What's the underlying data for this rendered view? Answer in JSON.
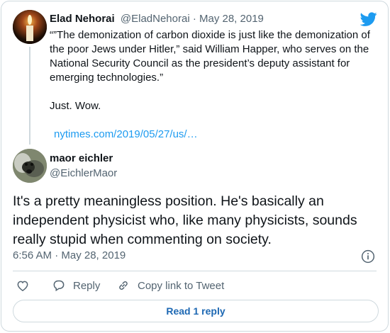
{
  "parent": {
    "name": "Elad Nehorai",
    "handle": "@EladNehorai · May 28, 2019",
    "text_lines": [
      "“”The demonization of carbon dioxide is just like the demonization of the poor Jews under Hitler,” said William Happer, who serves on the National Security Council as the president’s deputy assistant for emerging technologies.”"
    ],
    "text_wow": "Just. Wow.",
    "link": "nytimes.com/2019/05/27/us/…"
  },
  "reply": {
    "name": "maor eichler",
    "handle": "@EichlerMaor",
    "text": "It's a pretty meaningless position. He's basically an independent physicist who, like many physicists, sounds really stupid when commenting on society.",
    "timestamp": "6:56 AM · May 28, 2019"
  },
  "actions": {
    "reply_label": "Reply",
    "copy_label": "Copy link to Tweet"
  },
  "read_replies_label": "Read 1 reply",
  "icons": {
    "twitter": "twitter-bird-icon",
    "like": "heart-icon",
    "reply": "comment-icon",
    "copy": "link-icon",
    "info": "info-icon"
  },
  "colors": {
    "accent": "#1d9bf0",
    "secondary_text": "#536471",
    "border": "#cfd9de"
  }
}
